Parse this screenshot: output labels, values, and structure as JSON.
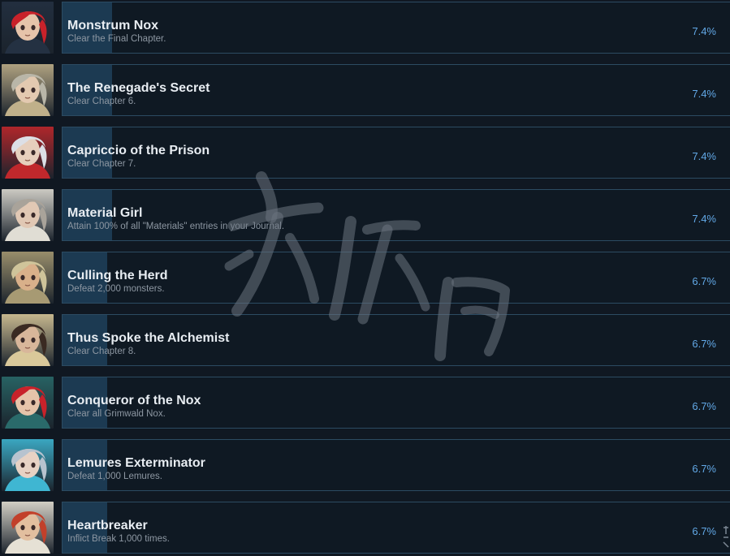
{
  "achievements": [
    {
      "title": "Monstrum Nox",
      "description": "Clear the Final Chapter.",
      "percent": "7.4%",
      "progress": 7.4,
      "hair": "#c8222a",
      "skin": "#e6c4aa",
      "accent": "#243142"
    },
    {
      "title": "The Renegade's Secret",
      "description": "Clear Chapter 6.",
      "percent": "7.4%",
      "progress": 7.4,
      "hair": "#b9b6a8",
      "skin": "#e3c9b0",
      "accent": "#c0b08a"
    },
    {
      "title": "Capriccio of the Prison",
      "description": "Clear Chapter 7.",
      "percent": "7.4%",
      "progress": 7.4,
      "hair": "#dcdfe6",
      "skin": "#e6cfbd",
      "accent": "#c0282c"
    },
    {
      "title": "Material Girl",
      "description": "Attain 100% of all \"Materials\" entries in your Journal.",
      "percent": "7.4%",
      "progress": 7.4,
      "hair": "#a9a39a",
      "skin": "#e1c8b4",
      "accent": "#e0ddd4"
    },
    {
      "title": "Culling the Herd",
      "description": "Defeat 2,000 monsters.",
      "percent": "6.7%",
      "progress": 6.7,
      "hair": "#cfc49a",
      "skin": "#d9b08a",
      "accent": "#a79a73"
    },
    {
      "title": "Thus Spoke the Alchemist",
      "description": "Clear Chapter 8.",
      "percent": "6.7%",
      "progress": 6.7,
      "hair": "#3a2a22",
      "skin": "#d8b69a",
      "accent": "#d9c89a"
    },
    {
      "title": "Conqueror of the Nox",
      "description": "Clear all Grimwald Nox.",
      "percent": "6.7%",
      "progress": 6.7,
      "hair": "#c8222a",
      "skin": "#e6c4aa",
      "accent": "#2a6a6a"
    },
    {
      "title": "Lemures Exterminator",
      "description": "Defeat 1,000 Lemures.",
      "percent": "6.7%",
      "progress": 6.7,
      "hair": "#b7c3cf",
      "skin": "#e7d2c4",
      "accent": "#3fb6d2"
    },
    {
      "title": "Heartbreaker",
      "description": "Inflict Break 1,000 times.",
      "percent": "6.7%",
      "progress": 6.7,
      "hair": "#c2402a",
      "skin": "#e2bf9f",
      "accent": "#e6e1d5"
    }
  ],
  "colors": {
    "background": "#101822",
    "panel": "#0f1923",
    "panel_border": "#2c4b62",
    "progress_fill": "#1c3a52",
    "title_text": "#e8edf2",
    "desc_text": "#8d97a2",
    "percent_text": "#62a8e6"
  },
  "icons": {
    "achievement_image": "anime-character-portrait",
    "watermark": "translucent-site-watermark"
  }
}
